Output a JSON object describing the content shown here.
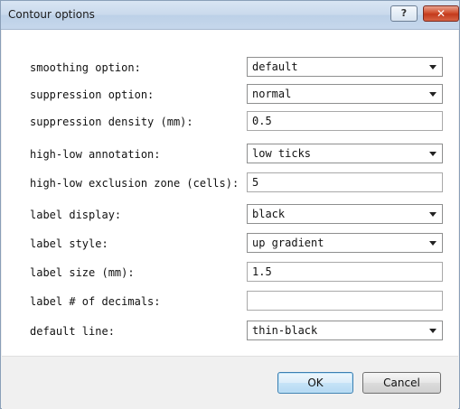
{
  "window": {
    "title": "Contour options",
    "help_label": "?",
    "close_label": "✕"
  },
  "rows": [
    {
      "label": "smoothing option:",
      "value": "default",
      "type": "select"
    },
    {
      "label": "suppression option:",
      "value": "normal",
      "type": "select"
    },
    {
      "label": "suppression density (mm):",
      "value": "0.5",
      "type": "text"
    },
    {
      "label": "high-low annotation:",
      "value": "low ticks",
      "type": "select"
    },
    {
      "label": "high-low exclusion zone (cells):",
      "value": "5",
      "type": "text"
    },
    {
      "label": "label display:",
      "value": "black",
      "type": "select"
    },
    {
      "label": "label style:",
      "value": "up gradient",
      "type": "select"
    },
    {
      "label": "label size (mm):",
      "value": "1.5",
      "type": "text"
    },
    {
      "label": "label # of decimals:",
      "value": "",
      "type": "text"
    },
    {
      "label": "default line:",
      "value": "thin-black",
      "type": "select"
    }
  ],
  "buttons": {
    "ok_label": "OK",
    "cancel_label": "Cancel"
  },
  "colors": {
    "titlebar": "#c9d9ec",
    "close_button": "#c33a1c",
    "dialog_background": "#f0f0f0"
  }
}
